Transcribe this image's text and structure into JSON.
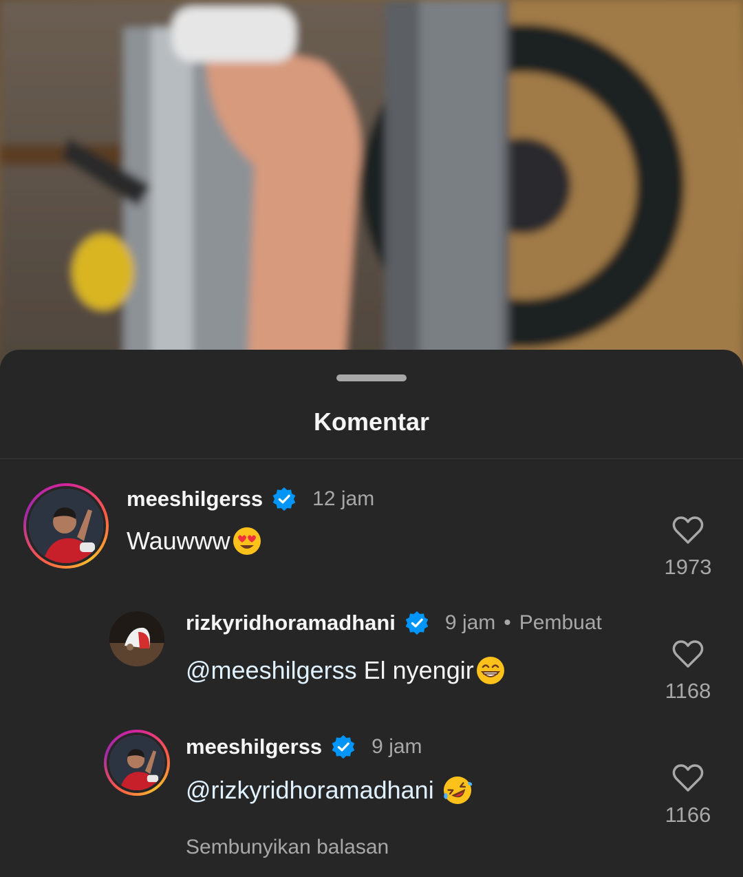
{
  "sheet": {
    "title": "Komentar"
  },
  "comments": [
    {
      "username": "meeshilgerss",
      "time": "12 jam",
      "text": "Wauwww",
      "emoji": "heart-eyes-emoji",
      "likes": "1973"
    },
    {
      "username": "rizkyridhoramadhani",
      "time": "9 jam",
      "dot": "•",
      "badge": "Pembuat",
      "mention": "@meeshilgerss",
      "text": " El nyengir",
      "emoji": "grin-emoji",
      "likes": "1168"
    },
    {
      "username": "meeshilgerss",
      "time": "9 jam",
      "mention": "@rizkyridhoramadhani",
      "text": " ",
      "emoji": "rofl-emoji",
      "likes": "1166"
    }
  ],
  "hide_replies_label": "Sembunyikan balasan",
  "colors": {
    "sheet_bg": "#262626",
    "verified_blue": "#0095f6",
    "muted_text": "#a8a8a8",
    "mention_text": "#e0f1ff"
  }
}
